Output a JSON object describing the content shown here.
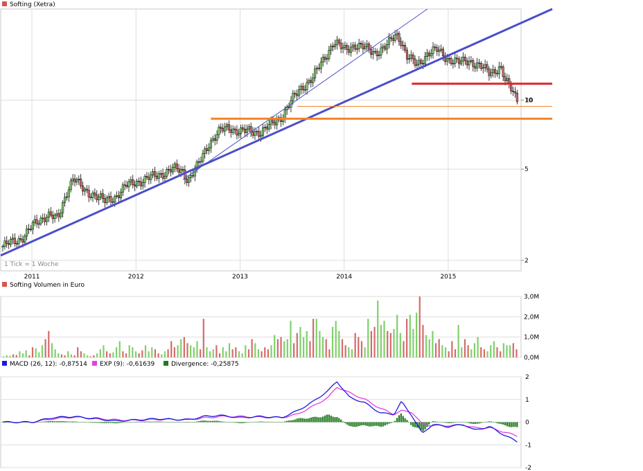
{
  "colors": {
    "price_swatch": "#d9534f",
    "volume_up": "#7fd06a",
    "volume_down": "#d46a6a",
    "trend_line": "#4a4ec8",
    "resistance_red": "#e0202a",
    "support_orange": "#f4832a",
    "macd": "#1a1ae0",
    "exp": "#e040e0",
    "divergence": "#1f7a1f",
    "grid": "#dddddd"
  },
  "price_panel": {
    "title": "Softing (Xetra)",
    "note": "1 Tick = 1 Woche",
    "last_label": "10"
  },
  "volume_panel": {
    "title": "Softing Volumen in Euro"
  },
  "macd_panel": {
    "macd_label": "MACD (26, 12): -0,87514",
    "exp_label": "EXP (9): -0,61639",
    "div_label": "Divergence: -0,25875"
  },
  "chart_data": [
    {
      "type": "line",
      "name_label": "Softing (Xetra)",
      "scale": "log",
      "x_labels": [
        "2011",
        "2012",
        "2013",
        "2014",
        "2015"
      ],
      "x_years": [
        2011,
        2012,
        2013,
        2014,
        2015
      ],
      "x_range": [
        2010.7,
        2015.7
      ],
      "y_ticks": [
        2,
        5,
        10
      ],
      "ylim": [
        1.8,
        25
      ],
      "close_points": [
        [
          2010.72,
          2.3
        ],
        [
          2010.9,
          2.5
        ],
        [
          2011.0,
          2.8
        ],
        [
          2011.15,
          3.2
        ],
        [
          2011.25,
          3.0
        ],
        [
          2011.35,
          4.2
        ],
        [
          2011.4,
          4.6
        ],
        [
          2011.5,
          4.0
        ],
        [
          2011.6,
          3.9
        ],
        [
          2011.7,
          3.6
        ],
        [
          2011.8,
          3.8
        ],
        [
          2011.9,
          4.2
        ],
        [
          2012.0,
          4.4
        ],
        [
          2012.15,
          4.6
        ],
        [
          2012.25,
          4.8
        ],
        [
          2012.35,
          5.0
        ],
        [
          2012.45,
          4.9
        ],
        [
          2012.5,
          4.5
        ],
        [
          2012.6,
          5.2
        ],
        [
          2012.7,
          6.5
        ],
        [
          2012.8,
          7.3
        ],
        [
          2012.9,
          7.6
        ],
        [
          2013.0,
          7.3
        ],
        [
          2013.1,
          7.3
        ],
        [
          2013.2,
          7.3
        ],
        [
          2013.3,
          7.8
        ],
        [
          2013.4,
          8.5
        ],
        [
          2013.5,
          10.0
        ],
        [
          2013.6,
          11.5
        ],
        [
          2013.7,
          12.5
        ],
        [
          2013.8,
          15.0
        ],
        [
          2013.9,
          18.0
        ],
        [
          2014.0,
          16.5
        ],
        [
          2014.1,
          17.5
        ],
        [
          2014.2,
          16.8
        ],
        [
          2014.3,
          16.2
        ],
        [
          2014.4,
          17.0
        ],
        [
          2014.5,
          19.5
        ],
        [
          2014.55,
          18.2
        ],
        [
          2014.6,
          15.5
        ],
        [
          2014.7,
          14.2
        ],
        [
          2014.8,
          16.0
        ],
        [
          2014.9,
          16.5
        ],
        [
          2015.0,
          15.2
        ],
        [
          2015.1,
          14.5
        ],
        [
          2015.2,
          15.0
        ],
        [
          2015.3,
          14.0
        ],
        [
          2015.4,
          13.2
        ],
        [
          2015.5,
          14.0
        ],
        [
          2015.55,
          12.0
        ],
        [
          2015.62,
          11.0
        ],
        [
          2015.67,
          10.0
        ]
      ],
      "lines": [
        {
          "kind": "trend",
          "from": [
            2010.7,
            2.1
          ],
          "to": [
            2016.0,
            25.0
          ]
        },
        {
          "kind": "trend_thin",
          "from": [
            2012.45,
            4.5
          ],
          "to": [
            2014.8,
            25.0
          ]
        },
        {
          "kind": "resistance",
          "from": [
            2014.65,
            11.8
          ],
          "to": [
            2016.0,
            11.8
          ]
        },
        {
          "kind": "support",
          "from": [
            2012.72,
            8.3
          ],
          "to": [
            2016.0,
            8.3
          ]
        },
        {
          "kind": "support_thin",
          "from": [
            2013.55,
            9.4
          ],
          "to": [
            2016.0,
            9.4
          ]
        }
      ]
    },
    {
      "type": "bar",
      "name_label": "Softing Volumen in Euro",
      "y_ticks": [
        "0,0M",
        "1,0M",
        "2,0M",
        "3,0M"
      ],
      "y_values": [
        0,
        1,
        2,
        3
      ],
      "ylim": [
        0,
        3.0
      ],
      "unit": "M EUR",
      "values": [
        0.05,
        0.1,
        0.08,
        0.15,
        0.12,
        0.3,
        0.2,
        0.35,
        0.1,
        0.5,
        0.45,
        0.25,
        0.6,
        0.9,
        1.3,
        0.7,
        0.4,
        0.2,
        0.15,
        0.1,
        0.3,
        0.15,
        0.1,
        0.5,
        0.3,
        0.2,
        0.1,
        0.05,
        0.1,
        0.2,
        0.4,
        0.6,
        0.3,
        0.2,
        0.25,
        0.5,
        0.8,
        0.3,
        0.2,
        0.6,
        0.5,
        0.3,
        0.2,
        0.35,
        0.6,
        0.3,
        0.5,
        0.4,
        0.2,
        0.15,
        0.3,
        0.4,
        0.8,
        0.5,
        0.6,
        0.9,
        1.0,
        0.7,
        0.6,
        0.5,
        0.8,
        0.4,
        1.9,
        0.5,
        0.3,
        0.4,
        0.6,
        0.2,
        0.5,
        0.3,
        0.7,
        0.4,
        0.5,
        0.3,
        0.2,
        0.6,
        0.4,
        0.9,
        0.7,
        0.4,
        0.3,
        0.5,
        0.4,
        0.6,
        1.1,
        0.9,
        1.0,
        0.8,
        0.9,
        1.8,
        0.7,
        1.2,
        1.5,
        1.0,
        1.3,
        0.8,
        1.9,
        1.9,
        1.3,
        1.0,
        0.9,
        0.4,
        1.5,
        1.8,
        1.3,
        0.9,
        0.6,
        0.5,
        0.4,
        1.2,
        1.0,
        0.8,
        0.5,
        1.9,
        1.3,
        1.5,
        2.8,
        1.6,
        1.8,
        1.3,
        1.2,
        1.4,
        2.1,
        1.2,
        0.8,
        1.9,
        2.1,
        1.4,
        2.2,
        3.0,
        1.6,
        1.1,
        0.9,
        1.3,
        0.7,
        0.9,
        0.6,
        0.5,
        0.3,
        0.8,
        0.4,
        1.6,
        0.5,
        0.9,
        0.6,
        0.4,
        0.7,
        1.0,
        0.5,
        0.4,
        0.3,
        0.6,
        0.8,
        0.5,
        0.3,
        0.7,
        0.6,
        0.6,
        0.7,
        0.4
      ],
      "colors": "alternating_by_price_change"
    },
    {
      "type": "line",
      "name_label": "MACD (26, 12)",
      "y_ticks": [
        -2,
        -1,
        0,
        1,
        2
      ],
      "ylim": [
        -2,
        2
      ],
      "macd": [
        [
          2010.7,
          0.0
        ],
        [
          2011.0,
          0.0
        ],
        [
          2011.2,
          0.2
        ],
        [
          2011.4,
          0.25
        ],
        [
          2011.6,
          0.15
        ],
        [
          2011.8,
          0.05
        ],
        [
          2012.0,
          0.1
        ],
        [
          2012.2,
          0.15
        ],
        [
          2012.5,
          0.1
        ],
        [
          2012.65,
          0.25
        ],
        [
          2012.8,
          0.3
        ],
        [
          2013.0,
          0.2
        ],
        [
          2013.2,
          0.25
        ],
        [
          2013.4,
          0.2
        ],
        [
          2013.55,
          0.5
        ],
        [
          2013.7,
          0.9
        ],
        [
          2013.85,
          1.4
        ],
        [
          2013.93,
          1.8
        ],
        [
          2014.05,
          1.1
        ],
        [
          2014.2,
          0.85
        ],
        [
          2014.35,
          0.4
        ],
        [
          2014.48,
          0.35
        ],
        [
          2014.55,
          0.9
        ],
        [
          2014.65,
          0.3
        ],
        [
          2014.75,
          -0.5
        ],
        [
          2014.85,
          -0.1
        ],
        [
          2015.0,
          -0.2
        ],
        [
          2015.15,
          -0.1
        ],
        [
          2015.25,
          -0.35
        ],
        [
          2015.4,
          -0.2
        ],
        [
          2015.55,
          -0.6
        ],
        [
          2015.67,
          -0.87
        ]
      ],
      "exp": [
        [
          2010.7,
          0.0
        ],
        [
          2011.0,
          0.0
        ],
        [
          2011.2,
          0.15
        ],
        [
          2011.4,
          0.22
        ],
        [
          2011.6,
          0.18
        ],
        [
          2011.8,
          0.1
        ],
        [
          2012.0,
          0.08
        ],
        [
          2012.2,
          0.12
        ],
        [
          2012.5,
          0.12
        ],
        [
          2012.65,
          0.18
        ],
        [
          2012.8,
          0.25
        ],
        [
          2013.0,
          0.25
        ],
        [
          2013.2,
          0.22
        ],
        [
          2013.4,
          0.2
        ],
        [
          2013.55,
          0.35
        ],
        [
          2013.7,
          0.7
        ],
        [
          2013.85,
          1.1
        ],
        [
          2013.93,
          1.55
        ],
        [
          2014.05,
          1.3
        ],
        [
          2014.2,
          1.0
        ],
        [
          2014.35,
          0.6
        ],
        [
          2014.48,
          0.35
        ],
        [
          2014.55,
          0.5
        ],
        [
          2014.65,
          0.45
        ],
        [
          2014.75,
          -0.1
        ],
        [
          2014.85,
          -0.15
        ],
        [
          2015.0,
          -0.15
        ],
        [
          2015.15,
          -0.12
        ],
        [
          2015.25,
          -0.25
        ],
        [
          2015.4,
          -0.25
        ],
        [
          2015.55,
          -0.45
        ],
        [
          2015.67,
          -0.62
        ]
      ],
      "divergence": [
        [
          2010.7,
          0.0
        ],
        [
          2011.0,
          0.0
        ],
        [
          2011.2,
          0.05
        ],
        [
          2011.4,
          0.03
        ],
        [
          2011.6,
          -0.03
        ],
        [
          2011.8,
          -0.05
        ],
        [
          2012.0,
          0.02
        ],
        [
          2012.2,
          0.03
        ],
        [
          2012.5,
          -0.02
        ],
        [
          2012.65,
          0.07
        ],
        [
          2012.8,
          0.05
        ],
        [
          2013.0,
          -0.05
        ],
        [
          2013.2,
          0.03
        ],
        [
          2013.4,
          0.0
        ],
        [
          2013.55,
          0.15
        ],
        [
          2013.7,
          0.2
        ],
        [
          2013.85,
          0.3
        ],
        [
          2013.93,
          0.25
        ],
        [
          2014.05,
          -0.2
        ],
        [
          2014.2,
          -0.15
        ],
        [
          2014.35,
          -0.2
        ],
        [
          2014.48,
          0.0
        ],
        [
          2014.55,
          0.4
        ],
        [
          2014.65,
          -0.15
        ],
        [
          2014.75,
          -0.4
        ],
        [
          2014.85,
          0.05
        ],
        [
          2015.0,
          -0.05
        ],
        [
          2015.15,
          0.02
        ],
        [
          2015.25,
          -0.1
        ],
        [
          2015.4,
          0.05
        ],
        [
          2015.55,
          -0.15
        ],
        [
          2015.67,
          -0.26
        ]
      ]
    }
  ]
}
